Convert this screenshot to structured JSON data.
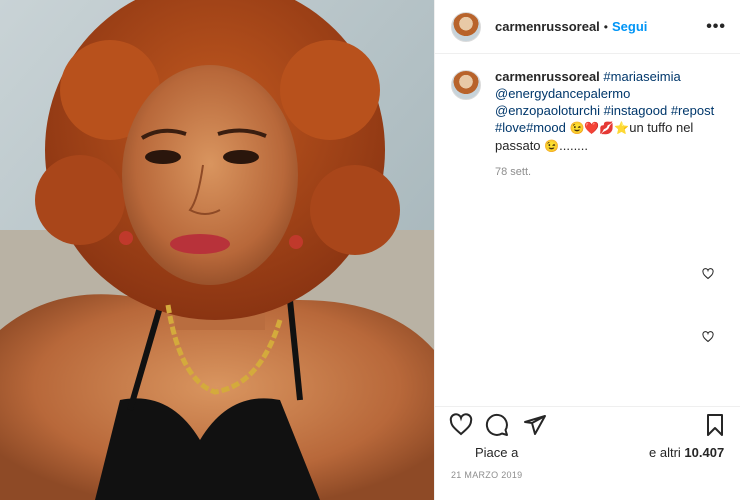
{
  "post": {
    "image_alt": "Foto di carmenrussoreal",
    "header": {
      "username": "carmenrussoreal",
      "separator": "•",
      "follow_label": "Segui",
      "more_label": "•••"
    },
    "caption": {
      "username": "carmenrussoreal",
      "part1": "#mariaseimia",
      "part2": "@energydancepalermo",
      "part3": "@enzopaoloturchi #instagood #repost",
      "part4": "#love#mood",
      "emojis1": "😉❤️💋⭐",
      "part5": "un tuffo nel",
      "part6": "passato",
      "emoji_end": "😉",
      "trail": "........",
      "time_ago": "78 sett."
    },
    "likes": {
      "prefix": "Piace a",
      "suffix": "e altri",
      "count": "10.407"
    },
    "date": "21 MARZO 2019"
  },
  "colors": {
    "link_blue": "#0095f6",
    "hashtag": "#00376b",
    "muted": "#8e8e8e",
    "text": "#262626"
  },
  "icons": {
    "like": "heart-icon",
    "comment": "comment-icon",
    "share": "share-icon",
    "save": "bookmark-icon",
    "more": "more-icon"
  }
}
